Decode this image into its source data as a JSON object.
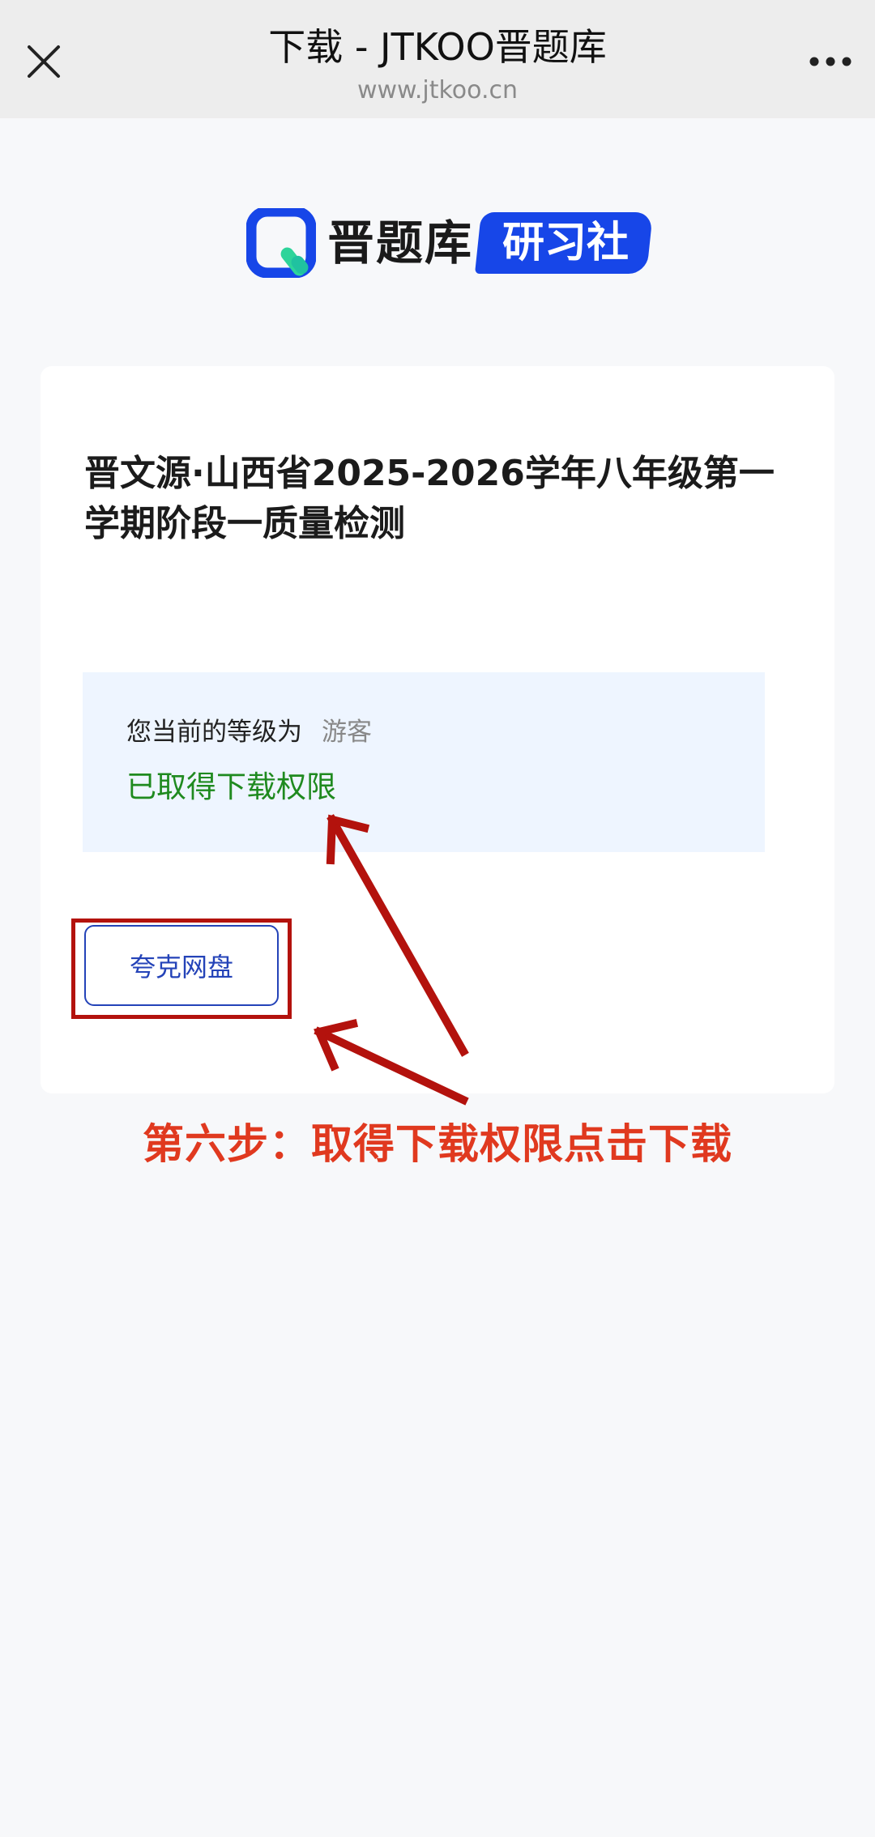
{
  "topbar": {
    "title": "下载 - JTKOO晋题库",
    "url": "www.jtkoo.cn",
    "close_icon": "close-icon",
    "more_icon": "more-icon"
  },
  "logo": {
    "name": "晋题库",
    "badge": "研习社",
    "brand_color": "#1746e8",
    "accent_color": "#2ed49a"
  },
  "card": {
    "doc_title": "晋文源·山西省2025-2026学年八年级第一学期阶段一质量检测",
    "level_label": "您当前的等级为",
    "level_value": "游客",
    "permission_text": "已取得下载权限",
    "download_button": "夸克网盘"
  },
  "annotation": {
    "step_text": "第六步：取得下载权限点击下载",
    "arrow_color": "#b3120d",
    "text_color": "#e0391f"
  }
}
